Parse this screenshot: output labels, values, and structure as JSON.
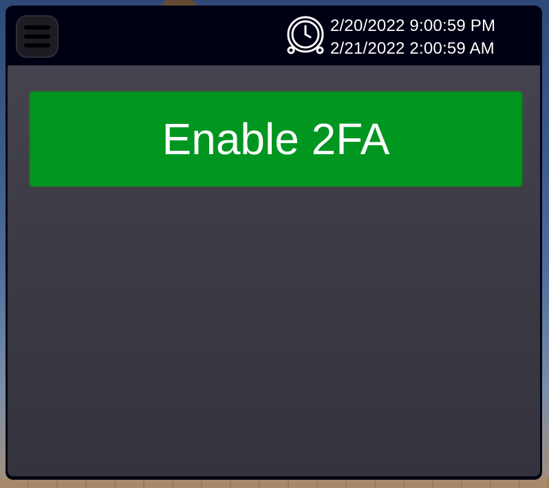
{
  "header": {
    "menu_icon": "hamburger-menu-icon",
    "clock_icon": "alarm-clock-icon",
    "time_line_1": "2/20/2022 9:00:59 PM",
    "time_line_2": "2/21/2022 2:00:59 AM"
  },
  "main": {
    "enable_2fa_label": "Enable 2FA"
  },
  "colors": {
    "header_bg": "#000014",
    "content_bg": "#3e3d47",
    "button_green": "#009620",
    "text": "#ffffff"
  }
}
